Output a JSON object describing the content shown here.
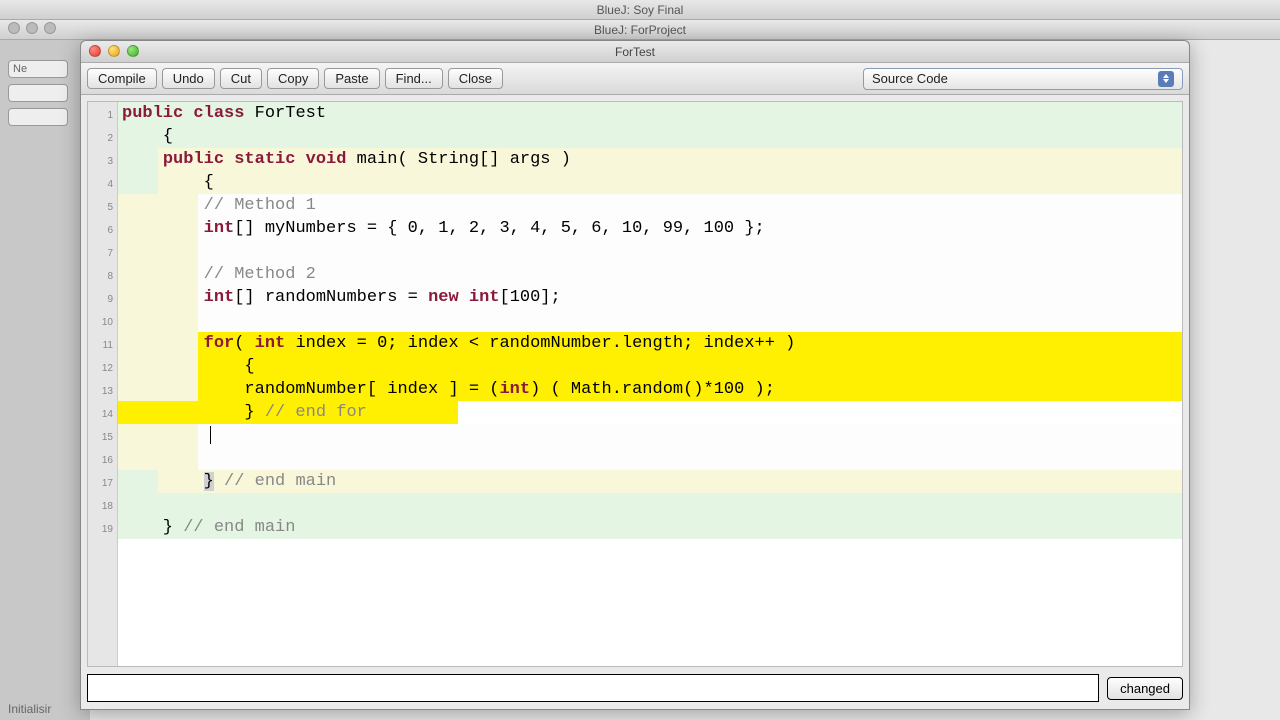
{
  "backgroundWindows": {
    "title1": "BlueJ:  Soy Final",
    "title2": "BlueJ:  ForProject",
    "leftButtons": [
      "Ne"
    ],
    "status": "Initialisir"
  },
  "editorWindow": {
    "title": "ForTest",
    "toolbar": {
      "compile": "Compile",
      "undo": "Undo",
      "cut": "Cut",
      "copy": "Copy",
      "paste": "Paste",
      "find": "Find...",
      "close": "Close"
    },
    "viewSelector": "Source Code",
    "status": "changed"
  },
  "code": {
    "lineCount": 19,
    "lines": [
      {
        "cls": "bg-class",
        "segs": [
          {
            "t": "public",
            "c": "kw"
          },
          {
            "t": " "
          },
          {
            "t": "class",
            "c": "kw"
          },
          {
            "t": " ForTest"
          }
        ]
      },
      {
        "cls": "bg-class",
        "segs": [
          {
            "t": "    {"
          }
        ]
      },
      {
        "cls": "bg-method",
        "ov": true,
        "segs": [
          {
            "t": "    "
          },
          {
            "t": "public",
            "c": "kw"
          },
          {
            "t": " "
          },
          {
            "t": "static",
            "c": "kw"
          },
          {
            "t": " "
          },
          {
            "t": "void",
            "c": "kw"
          },
          {
            "t": " main( String[] args )"
          }
        ]
      },
      {
        "cls": "bg-method",
        "ov": true,
        "segs": [
          {
            "t": "        {"
          }
        ]
      },
      {
        "cls": "bg-inner",
        "ov": true,
        "segs": [
          {
            "t": "        "
          },
          {
            "t": "// Method 1",
            "c": "cm"
          }
        ]
      },
      {
        "cls": "bg-inner",
        "ov": true,
        "segs": [
          {
            "t": "        "
          },
          {
            "t": "int",
            "c": "type"
          },
          {
            "t": "[] myNumbers = { 0, 1, 2, 3, 4, 5, 6, 10, 99, 100 };"
          }
        ]
      },
      {
        "cls": "bg-inner",
        "ov": true,
        "segs": [
          {
            "t": " "
          }
        ]
      },
      {
        "cls": "bg-inner",
        "ov": true,
        "segs": [
          {
            "t": "        "
          },
          {
            "t": "// Method 2",
            "c": "cm"
          }
        ]
      },
      {
        "cls": "bg-inner",
        "ov": true,
        "segs": [
          {
            "t": "        "
          },
          {
            "t": "int",
            "c": "type"
          },
          {
            "t": "[] randomNumbers = "
          },
          {
            "t": "new",
            "c": "kw"
          },
          {
            "t": " "
          },
          {
            "t": "int",
            "c": "type"
          },
          {
            "t": "[100];"
          }
        ]
      },
      {
        "cls": "bg-inner",
        "ov": true,
        "segs": [
          {
            "t": " "
          }
        ]
      },
      {
        "cls": "hl-error",
        "ov": true,
        "segs": [
          {
            "t": "        "
          },
          {
            "t": "for",
            "c": "kw"
          },
          {
            "t": "( "
          },
          {
            "t": "int",
            "c": "type"
          },
          {
            "t": " index = 0; index < randomNumber.length; index++ )"
          }
        ]
      },
      {
        "cls": "hl-error",
        "ov": true,
        "segs": [
          {
            "t": "            {"
          }
        ]
      },
      {
        "cls": "hl-error",
        "ov": true,
        "segs": [
          {
            "t": "            randomNumber[ index ] = ("
          },
          {
            "t": "int",
            "c": "type"
          },
          {
            "t": ") ( Math.random()*100 );"
          }
        ]
      },
      {
        "cls": "hl-error-end",
        "ov": false,
        "segs": [
          {
            "t": "            } "
          },
          {
            "t": "// end for",
            "c": "cm"
          }
        ]
      },
      {
        "cls": "bg-inner",
        "ov": true,
        "segs": [
          {
            "t": " "
          }
        ]
      },
      {
        "cls": "bg-inner",
        "ov": true,
        "segs": [
          {
            "t": " "
          }
        ]
      },
      {
        "cls": "bg-method",
        "ov": true,
        "segs": [
          {
            "t": "        ",
            "c": ""
          },
          {
            "t": "}",
            "c": "brace-hi"
          },
          {
            "t": " "
          },
          {
            "t": "// end main",
            "c": "cm"
          }
        ]
      },
      {
        "cls": "bg-class",
        "segs": [
          {
            "t": " "
          }
        ]
      },
      {
        "cls": "bg-class",
        "segs": [
          {
            "t": "    } "
          },
          {
            "t": "// end main",
            "c": "cm"
          }
        ]
      }
    ]
  }
}
